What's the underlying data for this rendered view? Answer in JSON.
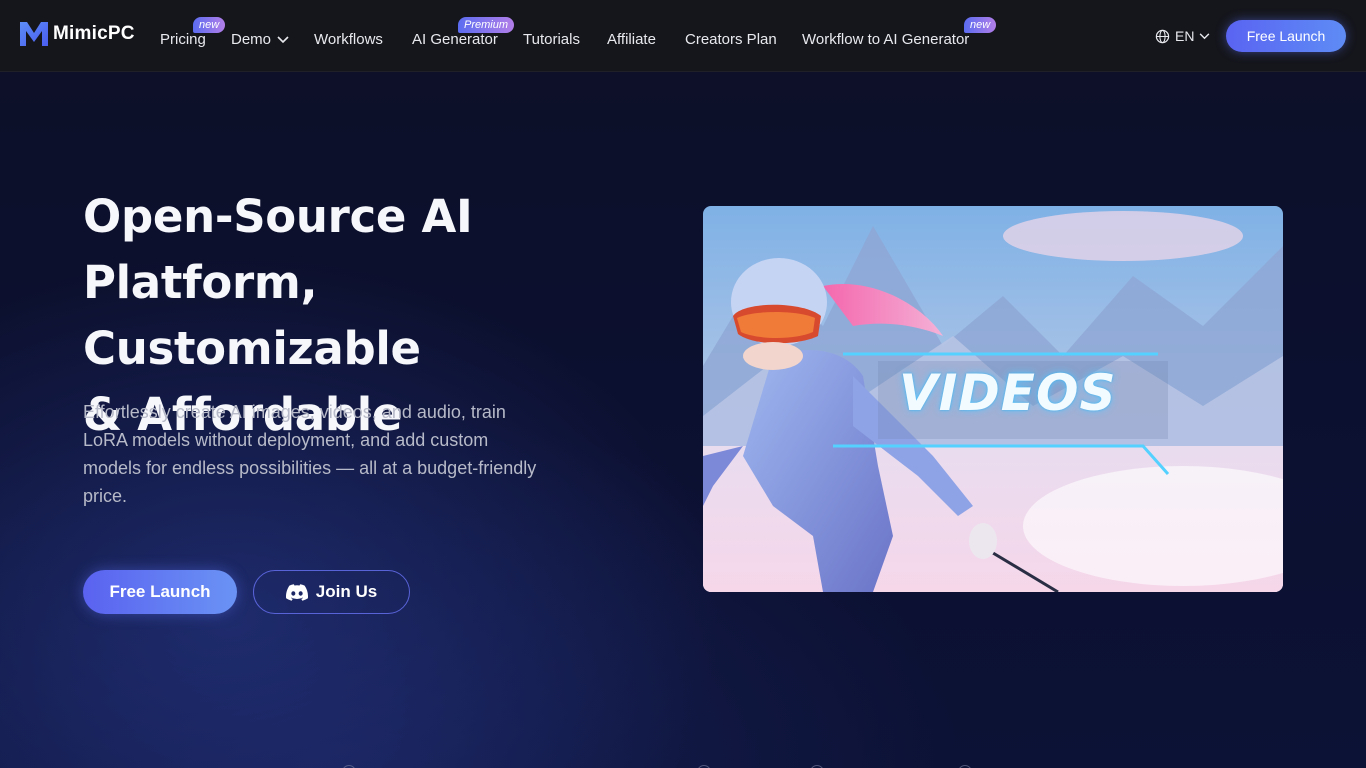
{
  "nav": {
    "logo_text": "MimicPC",
    "items": [
      {
        "label": "Pricing",
        "badge": "new"
      },
      {
        "label": "Demo",
        "has_dropdown": true
      },
      {
        "label": "Workflows"
      },
      {
        "label": "AI Generator",
        "badge": "Premium"
      },
      {
        "label": "Tutorials"
      },
      {
        "label": "Affiliate"
      },
      {
        "label": "Creators Plan"
      },
      {
        "label": "Workflow to AI Generator",
        "badge": "new"
      }
    ],
    "language": "EN",
    "cta_label": "Free Launch"
  },
  "hero": {
    "title_line1": "Open-Source AI",
    "title_line2": "Platform, Customizable",
    "title_line3": "& Affordable",
    "description": "Effortlessly create AI images, videos, and audio, train LoRA models without deployment, and add custom models for endless possibilities — all at a budget-friendly price.",
    "primary_button": "Free Launch",
    "secondary_button": "Join Us"
  },
  "media": {
    "overlay_text": "VIDEOS"
  },
  "icons": {
    "logo": "mimicpc-logo-icon",
    "globe": "globe-icon",
    "discord": "discord-icon",
    "chevron": "chevron-down-icon"
  },
  "colors": {
    "accent_start": "#5a62f0",
    "accent_end": "#6a93f4",
    "badge_start": "#5b6cf0",
    "badge_end": "#b27ee8",
    "nav_bg": "#15161c",
    "page_bg": "#0c1030"
  }
}
